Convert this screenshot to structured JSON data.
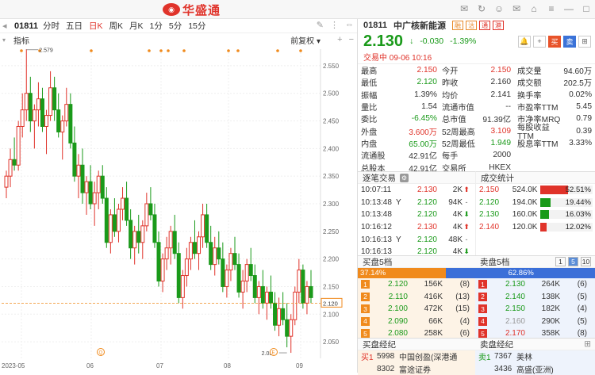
{
  "app": {
    "title": "华盛通"
  },
  "chart_header": {
    "symbol": "01811",
    "periods": [
      "分时",
      "五日",
      "日K",
      "周K",
      "月K",
      "1分",
      "5分",
      "15分"
    ],
    "active_period": "日K",
    "indicator": "指标",
    "adjust": "前复权"
  },
  "chart_data": {
    "type": "candlestick",
    "y_ticks": [
      "2.550",
      "2.500",
      "2.450",
      "2.400",
      "2.350",
      "2.300",
      "2.250",
      "2.200",
      "2.150",
      "2.100",
      "2.050"
    ],
    "y_values": [
      2.55,
      2.5,
      2.45,
      2.4,
      2.35,
      2.3,
      2.25,
      2.2,
      2.15,
      2.12,
      2.1,
      2.05
    ],
    "ylim": [
      2.02,
      2.58
    ],
    "x_labels": [
      "2023-05",
      "06",
      "07",
      "08",
      "09"
    ],
    "current_price_label": "2.120",
    "high_label": "2.579",
    "low_label": "2.030",
    "candles": [
      [
        2.33,
        2.36,
        2.31,
        2.35
      ],
      [
        2.35,
        2.4,
        2.33,
        2.38
      ],
      [
        2.38,
        2.42,
        2.36,
        2.37
      ],
      [
        2.37,
        2.45,
        2.36,
        2.44
      ],
      [
        2.44,
        2.5,
        2.42,
        2.47
      ],
      [
        2.47,
        2.58,
        2.45,
        2.5
      ],
      [
        2.5,
        2.53,
        2.43,
        2.45
      ],
      [
        2.45,
        2.48,
        2.4,
        2.47
      ],
      [
        2.47,
        2.52,
        2.44,
        2.49
      ],
      [
        2.49,
        2.51,
        2.43,
        2.44
      ],
      [
        2.44,
        2.47,
        2.39,
        2.46
      ],
      [
        2.46,
        2.54,
        2.45,
        2.51
      ],
      [
        2.51,
        2.53,
        2.45,
        2.47
      ],
      [
        2.47,
        2.5,
        2.42,
        2.43
      ],
      [
        2.43,
        2.46,
        2.38,
        2.45
      ],
      [
        2.45,
        2.51,
        2.44,
        2.48
      ],
      [
        2.48,
        2.5,
        2.4,
        2.41
      ],
      [
        2.41,
        2.44,
        2.34,
        2.35
      ],
      [
        2.35,
        2.39,
        2.31,
        2.37
      ],
      [
        2.37,
        2.4,
        2.3,
        2.32
      ],
      [
        2.32,
        2.35,
        2.28,
        2.34
      ],
      [
        2.34,
        2.37,
        2.29,
        2.3
      ],
      [
        2.3,
        2.34,
        2.26,
        2.32
      ],
      [
        2.32,
        2.36,
        2.29,
        2.35
      ],
      [
        2.35,
        2.37,
        2.3,
        2.31
      ],
      [
        2.31,
        2.33,
        2.22,
        2.23
      ],
      [
        2.23,
        2.29,
        2.21,
        2.28
      ],
      [
        2.28,
        2.31,
        2.24,
        2.25
      ],
      [
        2.25,
        2.3,
        2.23,
        2.29
      ],
      [
        2.29,
        2.33,
        2.27,
        2.31
      ],
      [
        2.31,
        2.34,
        2.26,
        2.27
      ],
      [
        2.27,
        2.29,
        2.2,
        2.22
      ],
      [
        2.22,
        2.26,
        2.19,
        2.25
      ],
      [
        2.25,
        2.28,
        2.21,
        2.23
      ],
      [
        2.23,
        2.27,
        2.2,
        2.26
      ],
      [
        2.26,
        2.32,
        2.25,
        2.3
      ],
      [
        2.3,
        2.33,
        2.27,
        2.28
      ],
      [
        2.28,
        2.3,
        2.22,
        2.23
      ],
      [
        2.23,
        2.25,
        2.15,
        2.16
      ],
      [
        2.16,
        2.21,
        2.14,
        2.2
      ],
      [
        2.2,
        2.24,
        2.18,
        2.22
      ],
      [
        2.22,
        2.26,
        2.19,
        2.25
      ],
      [
        2.25,
        2.28,
        2.2,
        2.21
      ],
      [
        2.21,
        2.23,
        2.12,
        2.13
      ],
      [
        2.13,
        2.18,
        2.11,
        2.17
      ],
      [
        2.17,
        2.22,
        2.15,
        2.2
      ],
      [
        2.2,
        2.24,
        2.18,
        2.23
      ],
      [
        2.23,
        2.27,
        2.2,
        2.21
      ],
      [
        2.21,
        2.25,
        2.18,
        2.24
      ],
      [
        2.24,
        2.3,
        2.22,
        2.28
      ],
      [
        2.28,
        2.3,
        2.22,
        2.23
      ],
      [
        2.23,
        2.26,
        2.18,
        2.19
      ],
      [
        2.19,
        2.24,
        2.17,
        2.22
      ],
      [
        2.22,
        2.25,
        2.19,
        2.2
      ],
      [
        2.2,
        2.23,
        2.14,
        2.15
      ],
      [
        2.15,
        2.19,
        2.13,
        2.18
      ],
      [
        2.18,
        2.22,
        2.16,
        2.21
      ],
      [
        2.21,
        2.24,
        2.18,
        2.19
      ],
      [
        2.19,
        2.21,
        2.13,
        2.14
      ],
      [
        2.14,
        2.18,
        2.11,
        2.16
      ],
      [
        2.16,
        2.2,
        2.14,
        2.19
      ],
      [
        2.19,
        2.22,
        2.16,
        2.17
      ],
      [
        2.17,
        2.19,
        2.12,
        2.13
      ],
      [
        2.13,
        2.16,
        2.1,
        2.15
      ],
      [
        2.15,
        2.18,
        2.11,
        2.12
      ],
      [
        2.12,
        2.15,
        2.09,
        2.14
      ],
      [
        2.14,
        2.17,
        2.11,
        2.12
      ],
      [
        2.12,
        2.14,
        2.07,
        2.08
      ],
      [
        2.08,
        2.13,
        2.06,
        2.11
      ],
      [
        2.11,
        2.14,
        2.08,
        2.09
      ],
      [
        2.09,
        2.12,
        2.04,
        2.06
      ],
      [
        2.06,
        2.1,
        2.03,
        2.09
      ],
      [
        2.09,
        2.15,
        2.08,
        2.14
      ],
      [
        2.14,
        2.2,
        2.12,
        2.18
      ],
      [
        2.18,
        2.19,
        2.11,
        2.12
      ],
      [
        2.12,
        2.16,
        2.1,
        2.15
      ],
      [
        2.15,
        2.18,
        2.12,
        2.13
      ]
    ]
  },
  "quote": {
    "code": "01811",
    "name": "中广核新能源",
    "tags": [
      "融",
      "沽",
      "通",
      "港"
    ],
    "price": "2.130",
    "change": "-0.030",
    "change_pct": "-1.39%",
    "status": "交易中 09-06 10:16",
    "buttons": {
      "buy": "买",
      "sell": "卖"
    },
    "rows": [
      [
        "最高",
        "2.150",
        "今开",
        "2.150",
        "成交量",
        "94.60万"
      ],
      [
        "最低",
        "2.120",
        "昨收",
        "2.160",
        "成交额",
        "202.5万"
      ],
      [
        "振幅",
        "1.39%",
        "均价",
        "2.141",
        "换手率",
        "0.02%"
      ],
      [
        "量比",
        "1.54",
        "流通市值",
        "--",
        "市盈率TTM",
        "5.45"
      ],
      [
        "委比",
        "-6.45%",
        "总市值",
        "91.39亿",
        "市净率MRQ",
        "0.79"
      ],
      [
        "外盘",
        "3.600万",
        "52周最高",
        "3.109",
        "每股收益TTM",
        "0.39"
      ],
      [
        "内盘",
        "65.00万",
        "52周最低",
        "1.949",
        "股息率TTM",
        "3.33%"
      ],
      [
        "流通股",
        "42.91亿",
        "每手",
        "2000",
        "",
        ""
      ],
      [
        "总股本",
        "42.91亿",
        "交易所",
        "HKEX",
        "",
        ""
      ]
    ]
  },
  "ticks": {
    "title": "逐笔交易",
    "rows": [
      [
        "10:07:11",
        "",
        "2.130",
        "2K",
        "up"
      ],
      [
        "10:13:48",
        "Y",
        "2.120",
        "94K",
        "dash"
      ],
      [
        "10:13:48",
        "",
        "2.120",
        "4K",
        "down"
      ],
      [
        "10:16:12",
        "",
        "2.130",
        "4K",
        "up"
      ],
      [
        "10:16:13",
        "Y",
        "2.120",
        "48K",
        "dash"
      ],
      [
        "10:16:13",
        "",
        "2.120",
        "4K",
        "down"
      ]
    ]
  },
  "volstat": {
    "title": "成交统计",
    "rows": [
      [
        "2.150",
        "524.0K",
        "52.51%",
        0.5251,
        "#e0332a"
      ],
      [
        "2.120",
        "194.0K",
        "19.44%",
        0.1944,
        "#1a9a1a"
      ],
      [
        "2.130",
        "160.0K",
        "16.03%",
        0.1603,
        "#1a9a1a"
      ],
      [
        "2.140",
        "120.0K",
        "12.02%",
        0.1202,
        "#e0332a"
      ]
    ]
  },
  "bid": {
    "title": "买盘5档",
    "pct": "37.14%",
    "ratio": 0.3714,
    "rows": [
      [
        "1",
        "2.120",
        "156K",
        "(8)"
      ],
      [
        "2",
        "2.110",
        "416K",
        "(13)"
      ],
      [
        "3",
        "2.100",
        "472K",
        "(15)"
      ],
      [
        "4",
        "2.090",
        "66K",
        "(4)"
      ],
      [
        "5",
        "2.080",
        "258K",
        "(6)"
      ]
    ]
  },
  "ask": {
    "title": "卖盘5档",
    "pct": "62.86%",
    "rows": [
      [
        "1",
        "2.130",
        "264K",
        "(6)"
      ],
      [
        "2",
        "2.140",
        "138K",
        "(5)"
      ],
      [
        "3",
        "2.150",
        "182K",
        "(4)"
      ],
      [
        "4",
        "2.160",
        "290K",
        "(5)"
      ],
      [
        "5",
        "2.170",
        "358K",
        "(8)"
      ]
    ],
    "pages": [
      "1",
      "5",
      "10"
    ]
  },
  "brokers_buy": {
    "title": "买盘经纪",
    "rows": [
      [
        "买1",
        "5998",
        "中国创盈(深港通"
      ],
      [
        "",
        "8302",
        "富途证券"
      ]
    ]
  },
  "brokers_sell": {
    "title": "卖盘经纪",
    "rows": [
      [
        "卖1",
        "7367",
        "美林"
      ],
      [
        "",
        "3436",
        "高盛(亚洲)"
      ]
    ]
  }
}
